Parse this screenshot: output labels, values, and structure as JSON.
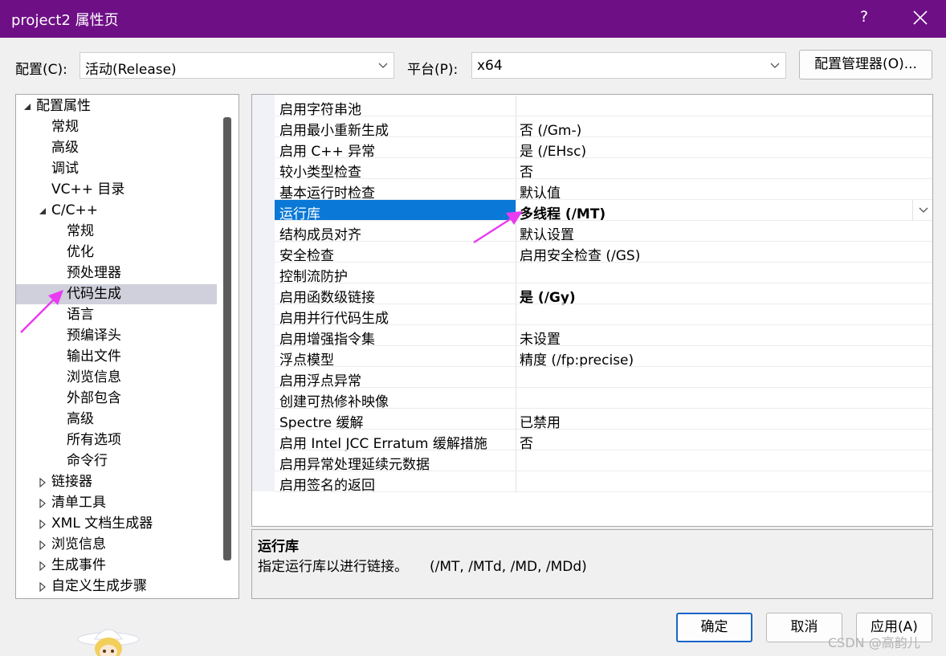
{
  "window": {
    "title": "project2 属性页",
    "help": "?"
  },
  "toolbar": {
    "config_label": "配置(C):",
    "config_value": "活动(Release)",
    "platform_label": "平台(P):",
    "platform_value": "x64",
    "config_manager": "配置管理器(O)..."
  },
  "tree": {
    "items": [
      {
        "label": "配置属性"
      },
      {
        "label": "常规"
      },
      {
        "label": "高级"
      },
      {
        "label": "调试"
      },
      {
        "label": "VC++ 目录"
      },
      {
        "label": "C/C++"
      },
      {
        "label": "常规"
      },
      {
        "label": "优化"
      },
      {
        "label": "预处理器"
      },
      {
        "label": "代码生成"
      },
      {
        "label": "语言"
      },
      {
        "label": "预编译头"
      },
      {
        "label": "输出文件"
      },
      {
        "label": "浏览信息"
      },
      {
        "label": "外部包含"
      },
      {
        "label": "高级"
      },
      {
        "label": "所有选项"
      },
      {
        "label": "命令行"
      },
      {
        "label": "链接器"
      },
      {
        "label": "清单工具"
      },
      {
        "label": "XML 文档生成器"
      },
      {
        "label": "浏览信息"
      },
      {
        "label": "生成事件"
      },
      {
        "label": "自定义生成步骤"
      }
    ]
  },
  "grid": {
    "rows": [
      {
        "name": "启用字符串池",
        "value": ""
      },
      {
        "name": "启用最小重新生成",
        "value": "否 (/Gm-)"
      },
      {
        "name": "启用 C++ 异常",
        "value": "是 (/EHsc)"
      },
      {
        "name": "较小类型检查",
        "value": "否"
      },
      {
        "name": "基本运行时检查",
        "value": "默认值"
      },
      {
        "name": "运行库",
        "value": "多线程 (/MT)"
      },
      {
        "name": "结构成员对齐",
        "value": "默认设置"
      },
      {
        "name": "安全检查",
        "value": "启用安全检查 (/GS)"
      },
      {
        "name": "控制流防护",
        "value": ""
      },
      {
        "name": "启用函数级链接",
        "value": "是 (/Gy)"
      },
      {
        "name": "启用并行代码生成",
        "value": ""
      },
      {
        "name": "启用增强指令集",
        "value": "未设置"
      },
      {
        "name": "浮点模型",
        "value": "精度 (/fp:precise)"
      },
      {
        "name": "启用浮点异常",
        "value": ""
      },
      {
        "name": "创建可热修补映像",
        "value": ""
      },
      {
        "name": "Spectre 缓解",
        "value": "已禁用"
      },
      {
        "name": "启用 Intel JCC Erratum 缓解措施",
        "value": "否"
      },
      {
        "name": "启用异常处理延续元数据",
        "value": ""
      },
      {
        "name": "启用签名的返回",
        "value": ""
      }
    ]
  },
  "description": {
    "title": "运行库",
    "text": "指定运行库以进行链接。     (/MT, /MTd, /MD, /MDd)"
  },
  "buttons": {
    "ok": "确定",
    "cancel": "取消",
    "apply": "应用(A)"
  },
  "watermark": "CSDN @高韵儿",
  "colors": {
    "titlebar": "#6e0f86",
    "selection": "#0a78d6",
    "annotation": "#e93cf2"
  }
}
